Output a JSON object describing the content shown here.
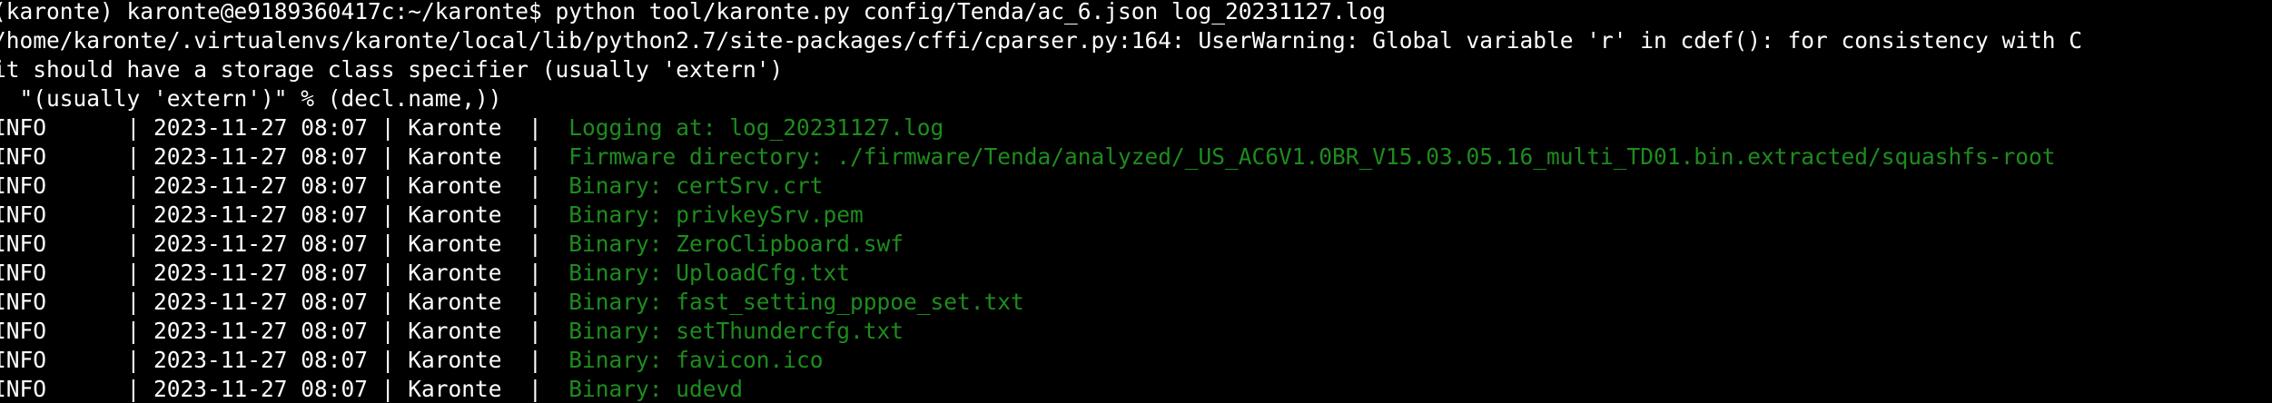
{
  "terminal": {
    "prompt": "(karonte) karonte@e9189360417c:~/karonte$ ",
    "command": "python tool/karonte.py config/Tenda/ac_6.json log_20231127.log",
    "warnings": [
      "/home/karonte/.virtualenvs/karonte/local/lib/python2.7/site-packages/cffi/cparser.py:164: UserWarning: Global variable 'r' in cdef(): for consistency with C",
      "it should have a storage class specifier (usually 'extern')",
      "  \"(usually 'extern')\" % (decl.name,))"
    ],
    "log_rows": [
      {
        "prefix": "INFO      | 2023-11-27 08:07 | Karonte  |  ",
        "message": "Logging at: log_20231127.log"
      },
      {
        "prefix": "INFO      | 2023-11-27 08:07 | Karonte  |  ",
        "message": "Firmware directory: ./firmware/Tenda/analyzed/_US_AC6V1.0BR_V15.03.05.16_multi_TD01.bin.extracted/squashfs-root"
      },
      {
        "prefix": "INFO      | 2023-11-27 08:07 | Karonte  |  ",
        "message": "Binary: certSrv.crt"
      },
      {
        "prefix": "INFO      | 2023-11-27 08:07 | Karonte  |  ",
        "message": "Binary: privkeySrv.pem"
      },
      {
        "prefix": "INFO      | 2023-11-27 08:07 | Karonte  |  ",
        "message": "Binary: ZeroClipboard.swf"
      },
      {
        "prefix": "INFO      | 2023-11-27 08:07 | Karonte  |  ",
        "message": "Binary: UploadCfg.txt"
      },
      {
        "prefix": "INFO      | 2023-11-27 08:07 | Karonte  |  ",
        "message": "Binary: fast_setting_pppoe_set.txt"
      },
      {
        "prefix": "INFO      | 2023-11-27 08:07 | Karonte  |  ",
        "message": "Binary: setThundercfg.txt"
      },
      {
        "prefix": "INFO      | 2023-11-27 08:07 | Karonte  |  ",
        "message": "Binary: favicon.ico"
      },
      {
        "prefix": "INFO      | 2023-11-27 08:07 | Karonte  |  ",
        "message": "Binary: udevd"
      }
    ],
    "colors": {
      "background": "#000000",
      "text": "#ffffff",
      "log_message": "#1e8c1e"
    }
  }
}
